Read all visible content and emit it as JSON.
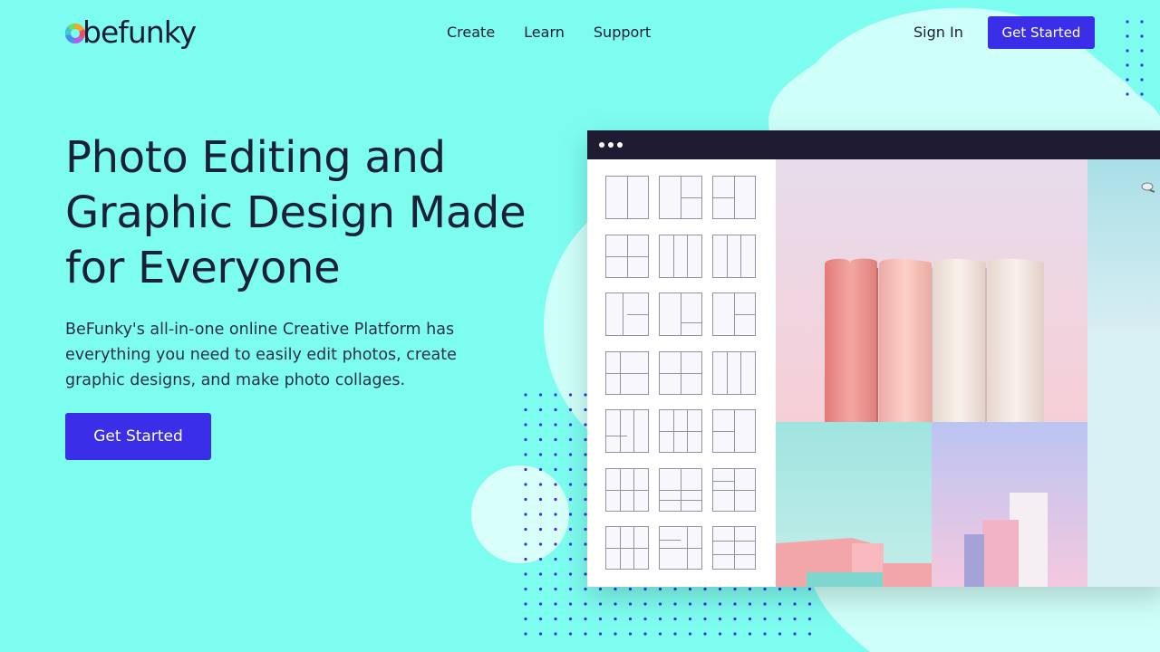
{
  "colors": {
    "background": "#7dfdf0",
    "primary_button": "#3b2ee8",
    "heading": "#1a2035",
    "app_titlebar": "#1e1b32",
    "dot_pattern": "#3b2ee8"
  },
  "header": {
    "logo_text": "befunky",
    "nav": [
      {
        "label": "Create"
      },
      {
        "label": "Learn"
      },
      {
        "label": "Support"
      }
    ],
    "sign_in": "Sign In",
    "cta": "Get Started"
  },
  "hero": {
    "title": "Photo Editing and Graphic Design Made for Everyone",
    "subtitle": "BeFunky's all-in-one online Creative Platform has everything you need to easily edit photos, create graphic designs, and make photo collages.",
    "cta": "Get Started"
  },
  "app_preview": {
    "window_controls": [
      "dot",
      "dot",
      "dot"
    ],
    "panel": "collage layout templates",
    "photos": [
      "pastel-silos-photo",
      "pastel-building-photo",
      "pastel-apartment-photo",
      "streetlamp-photo"
    ]
  }
}
